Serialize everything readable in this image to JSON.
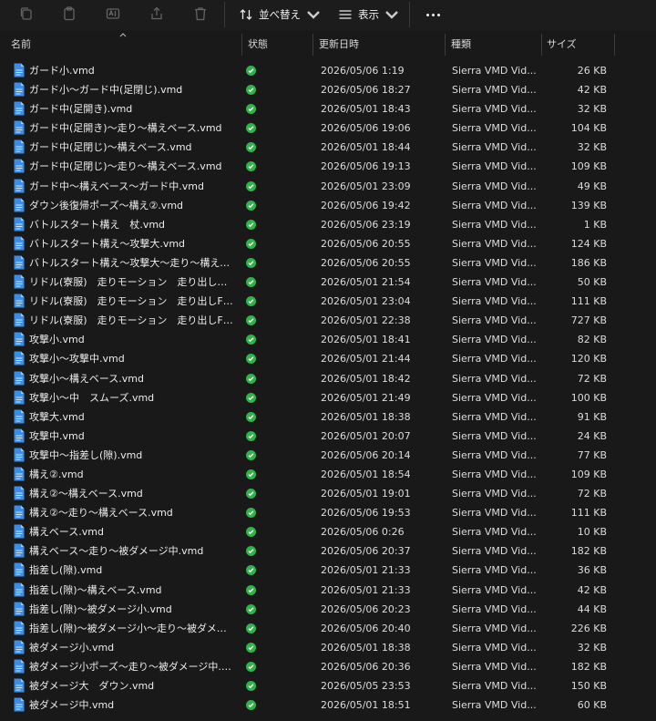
{
  "toolbar": {
    "icons": [
      "copy-icon",
      "paste-icon",
      "rename-icon",
      "share-icon",
      "delete-icon"
    ],
    "sort_label": "並べ替え",
    "view_label": "表示",
    "more_icon": "ellipsis-icon"
  },
  "headers": {
    "name": "名前",
    "status": "状態",
    "date": "更新日時",
    "type": "種類",
    "size": "サイズ"
  },
  "colors": {
    "status_ok": "#2fb34a",
    "file_icon": "#3a8ee6"
  },
  "files": [
    {
      "name": "ガード小.vmd",
      "date": "2026/05/06 1:19",
      "type": "Sierra VMD Vid...",
      "size": "26 KB"
    },
    {
      "name": "ガード小～ガード中(足閉じ).vmd",
      "date": "2026/05/06 18:27",
      "type": "Sierra VMD Vid...",
      "size": "42 KB"
    },
    {
      "name": "ガード中(足開き).vmd",
      "date": "2026/05/01 18:43",
      "type": "Sierra VMD Vid...",
      "size": "32 KB"
    },
    {
      "name": "ガード中(足開き)～走り～構えベース.vmd",
      "date": "2026/05/06 19:06",
      "type": "Sierra VMD Vid...",
      "size": "104 KB"
    },
    {
      "name": "ガード中(足閉じ)～構えベース.vmd",
      "date": "2026/05/01 18:44",
      "type": "Sierra VMD Vid...",
      "size": "32 KB"
    },
    {
      "name": "ガード中(足閉じ)～走り～構えベース.vmd",
      "date": "2026/05/06 19:13",
      "type": "Sierra VMD Vid...",
      "size": "109 KB"
    },
    {
      "name": "ガード中～構えベース～ガード中.vmd",
      "date": "2026/05/01 23:09",
      "type": "Sierra VMD Vid...",
      "size": "49 KB"
    },
    {
      "name": "ダウン後復帰ポーズ～構え②.vmd",
      "date": "2026/05/06 19:42",
      "type": "Sierra VMD Vid...",
      "size": "139 KB"
    },
    {
      "name": "バトルスタート構え　杖.vmd",
      "date": "2026/05/06 23:19",
      "type": "Sierra VMD Vid...",
      "size": "1 KB"
    },
    {
      "name": "バトルスタート構え～攻撃大.vmd",
      "date": "2026/05/06 20:55",
      "type": "Sierra VMD Vid...",
      "size": "124 KB"
    },
    {
      "name": "バトルスタート構え～攻撃大～走り～構えベー...",
      "date": "2026/05/06 20:55",
      "type": "Sierra VMD Vid...",
      "size": "186 KB"
    },
    {
      "name": "リドル(寮服)　走りモーション　走り出し～構...",
      "date": "2026/05/01 21:54",
      "type": "Sierra VMD Vid...",
      "size": "50 KB"
    },
    {
      "name": "リドル(寮服)　走りモーション　走り出しF0～...",
      "date": "2026/05/01 23:04",
      "type": "Sierra VMD Vid...",
      "size": "111 KB"
    },
    {
      "name": "リドル(寮服)　走りモーション　走り出しF0～...",
      "date": "2026/05/01 22:38",
      "type": "Sierra VMD Vid...",
      "size": "727 KB"
    },
    {
      "name": "攻撃小.vmd",
      "date": "2026/05/01 18:41",
      "type": "Sierra VMD Vid...",
      "size": "82 KB"
    },
    {
      "name": "攻撃小～攻撃中.vmd",
      "date": "2026/05/01 21:44",
      "type": "Sierra VMD Vid...",
      "size": "120 KB"
    },
    {
      "name": "攻撃小～構えベース.vmd",
      "date": "2026/05/01 18:42",
      "type": "Sierra VMD Vid...",
      "size": "72 KB"
    },
    {
      "name": "攻撃小～中　スムーズ.vmd",
      "date": "2026/05/01 21:49",
      "type": "Sierra VMD Vid...",
      "size": "100 KB"
    },
    {
      "name": "攻撃大.vmd",
      "date": "2026/05/01 18:38",
      "type": "Sierra VMD Vid...",
      "size": "91 KB"
    },
    {
      "name": "攻撃中.vmd",
      "date": "2026/05/01 20:07",
      "type": "Sierra VMD Vid...",
      "size": "24 KB"
    },
    {
      "name": "攻撃中～指差し(隙).vmd",
      "date": "2026/05/06 20:14",
      "type": "Sierra VMD Vid...",
      "size": "77 KB"
    },
    {
      "name": "構え②.vmd",
      "date": "2026/05/01 18:54",
      "type": "Sierra VMD Vid...",
      "size": "109 KB"
    },
    {
      "name": "構え②～構えベース.vmd",
      "date": "2026/05/01 19:01",
      "type": "Sierra VMD Vid...",
      "size": "72 KB"
    },
    {
      "name": "構え②～走り～構えベース.vmd",
      "date": "2026/05/06 19:53",
      "type": "Sierra VMD Vid...",
      "size": "111 KB"
    },
    {
      "name": "構えベース.vmd",
      "date": "2026/05/06 0:26",
      "type": "Sierra VMD Vid...",
      "size": "10 KB"
    },
    {
      "name": "構えベース～走り～被ダメージ中.vmd",
      "date": "2026/05/06 20:37",
      "type": "Sierra VMD Vid...",
      "size": "182 KB"
    },
    {
      "name": "指差し(隙).vmd",
      "date": "2026/05/01 21:33",
      "type": "Sierra VMD Vid...",
      "size": "36 KB"
    },
    {
      "name": "指差し(隙)～構えベース.vmd",
      "date": "2026/05/01 21:33",
      "type": "Sierra VMD Vid...",
      "size": "42 KB"
    },
    {
      "name": "指差し(隙)～被ダメージ小.vmd",
      "date": "2026/05/06 20:23",
      "type": "Sierra VMD Vid...",
      "size": "44 KB"
    },
    {
      "name": "指差し(隙)～被ダメージ小～走り～被ダメージ...",
      "date": "2026/05/06 20:40",
      "type": "Sierra VMD Vid...",
      "size": "226 KB"
    },
    {
      "name": "被ダメージ小.vmd",
      "date": "2026/05/01 18:38",
      "type": "Sierra VMD Vid...",
      "size": "32 KB"
    },
    {
      "name": "被ダメージ小ポーズ～走り～被ダメージ中.vmd",
      "date": "2026/05/06 20:36",
      "type": "Sierra VMD Vid...",
      "size": "182 KB"
    },
    {
      "name": "被ダメージ大　ダウン.vmd",
      "date": "2026/05/05 23:53",
      "type": "Sierra VMD Vid...",
      "size": "150 KB"
    },
    {
      "name": "被ダメージ中.vmd",
      "date": "2026/05/01 18:51",
      "type": "Sierra VMD Vid...",
      "size": "60 KB"
    }
  ]
}
